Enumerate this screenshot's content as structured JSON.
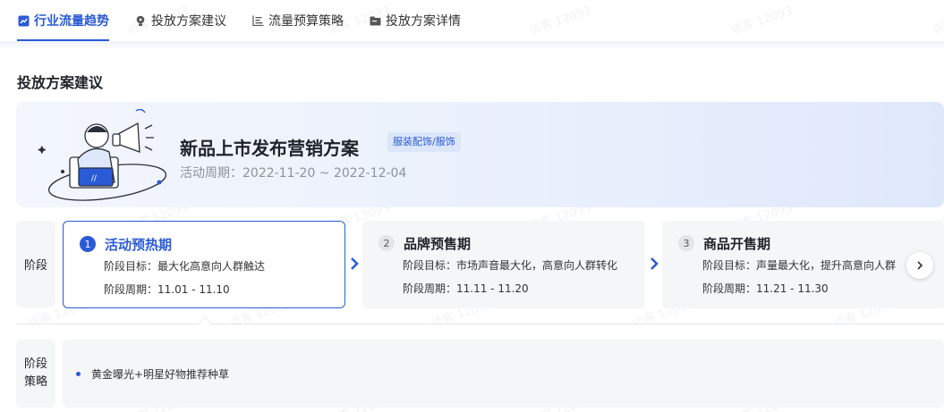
{
  "tabs": [
    {
      "label": "行业流量趋势",
      "icon": "trend-chart-icon",
      "active": true
    },
    {
      "label": "投放方案建议",
      "icon": "lightbulb-icon",
      "active": false
    },
    {
      "label": "流量预算策略",
      "icon": "bar-list-icon",
      "active": false
    },
    {
      "label": "投放方案详情",
      "icon": "folder-icon",
      "active": false
    }
  ],
  "section_title": "投放方案建议",
  "plan": {
    "title": "新品上市发布营销方案",
    "tag": "服装配饰/服饰",
    "period": "活动周期：2022-11-20 ~ 2022-12-04"
  },
  "stage_label": "阶段",
  "stages": [
    {
      "num": "1",
      "name": "活动预热期",
      "goal": "阶段目标：最大化高意向人群触达",
      "cycle": "阶段周期：11.01 - 11.10"
    },
    {
      "num": "2",
      "name": "品牌预售期",
      "goal": "阶段目标：市场声音最大化，高意向人群转化",
      "cycle": "阶段周期：11.11 - 11.20"
    },
    {
      "num": "3",
      "name": "商品开售期",
      "goal": "阶段目标：声量最大化，提升高意向人群",
      "cycle": "阶段周期：11.21 - 11.30"
    }
  ],
  "strategy_label": [
    "阶段",
    "策略"
  ],
  "strategies": [
    "黄金曝光+明星好物推荐种草"
  ],
  "watermark": "访客 12093",
  "colors": {
    "accent": "#2a5bd7"
  }
}
